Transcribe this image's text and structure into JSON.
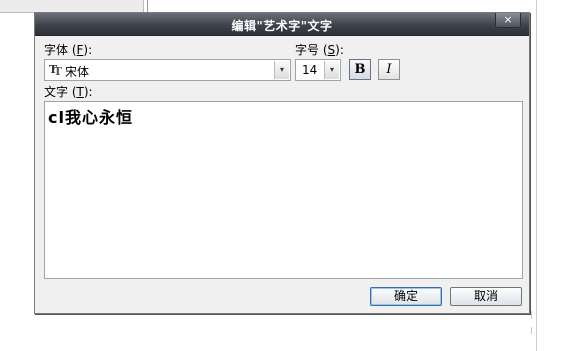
{
  "dialog": {
    "title": "编辑\"艺术字\"文字",
    "close_symbol": "×",
    "font_label": "字体",
    "font_hotkey": "F",
    "font_value": "宋体",
    "font_icon": "TT-font-icon",
    "size_label": "字号",
    "size_hotkey": "S",
    "size_value": "14",
    "bold_label": "B",
    "italic_label": "I",
    "text_label": "文字",
    "text_hotkey": "T",
    "text_value": "cl我心永恒",
    "ok_label": "确定",
    "cancel_label": "取消",
    "dropdown_arrow": "▾"
  }
}
